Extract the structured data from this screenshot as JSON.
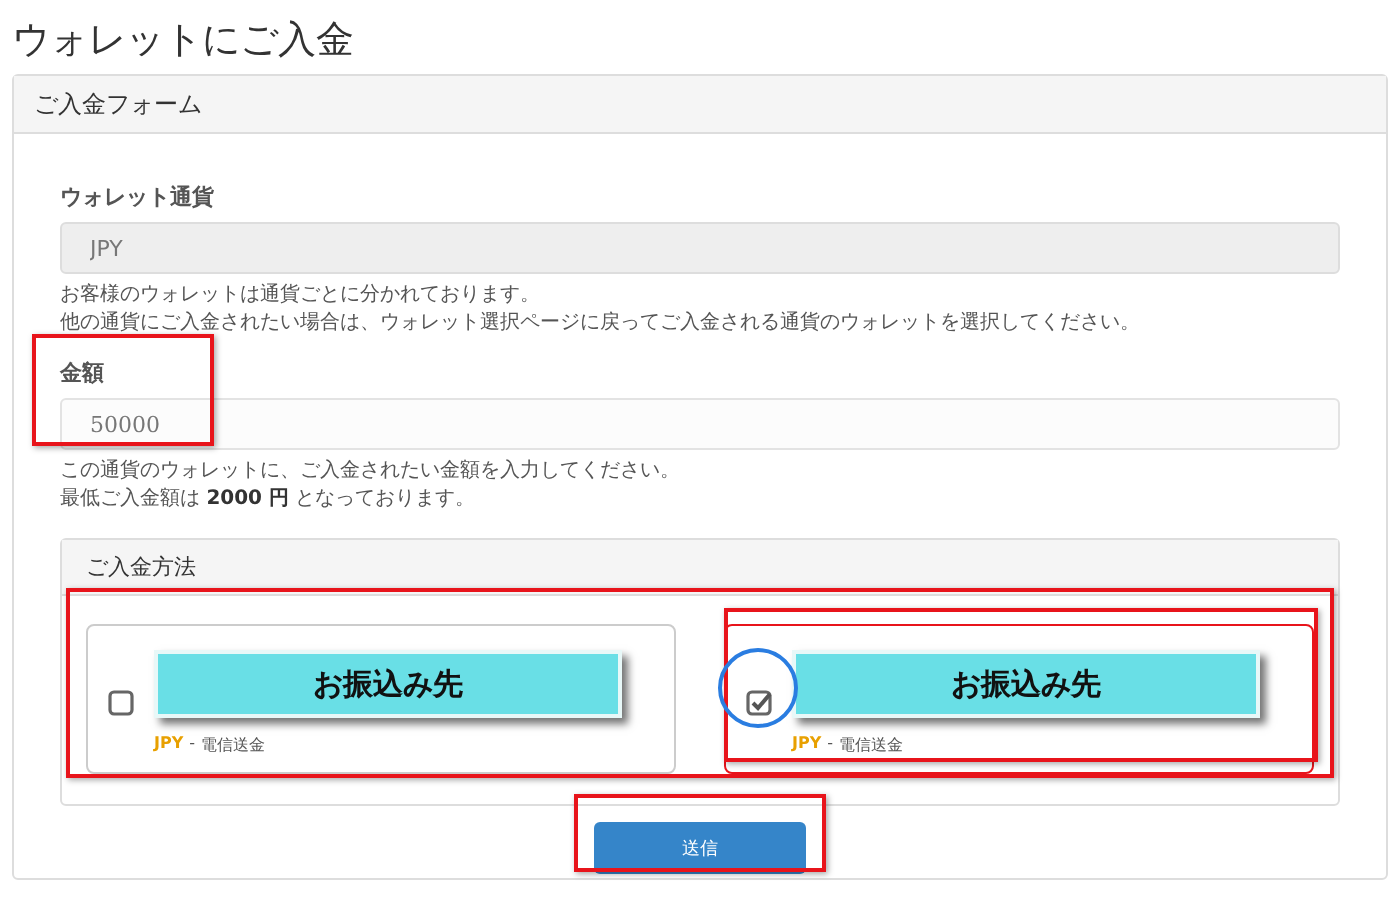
{
  "page_title": "ウォレットにご入金",
  "panel": {
    "title": "ご入金フォーム",
    "fields": [
      {
        "label": "ウォレット通貨",
        "value": "JPY",
        "disabled": true,
        "help": [
          "お客様のウォレットは通貨ごとに分かれております。",
          "他の通貨にご入金されたい場合は、ウォレット選択ページに戻ってご入金される通貨のウォレットを選択してください。"
        ]
      },
      {
        "label": "金額",
        "value": "50000",
        "disabled": false,
        "help": [
          "この通貨のウォレットに、ご入金されたい金額を入力してください。",
          "最低ご入金額は **2000 円** となっております。"
        ]
      }
    ],
    "methods": {
      "title": "ご入金方法",
      "options": [
        {
          "label": "お振込み先",
          "currency": "JPY",
          "separator": "-",
          "method": "電信送金",
          "selected": false
        },
        {
          "label": "お振込み先",
          "currency": "JPY",
          "separator": "-",
          "method": "電信送金",
          "selected": true
        }
      ]
    },
    "submit": "送信"
  }
}
